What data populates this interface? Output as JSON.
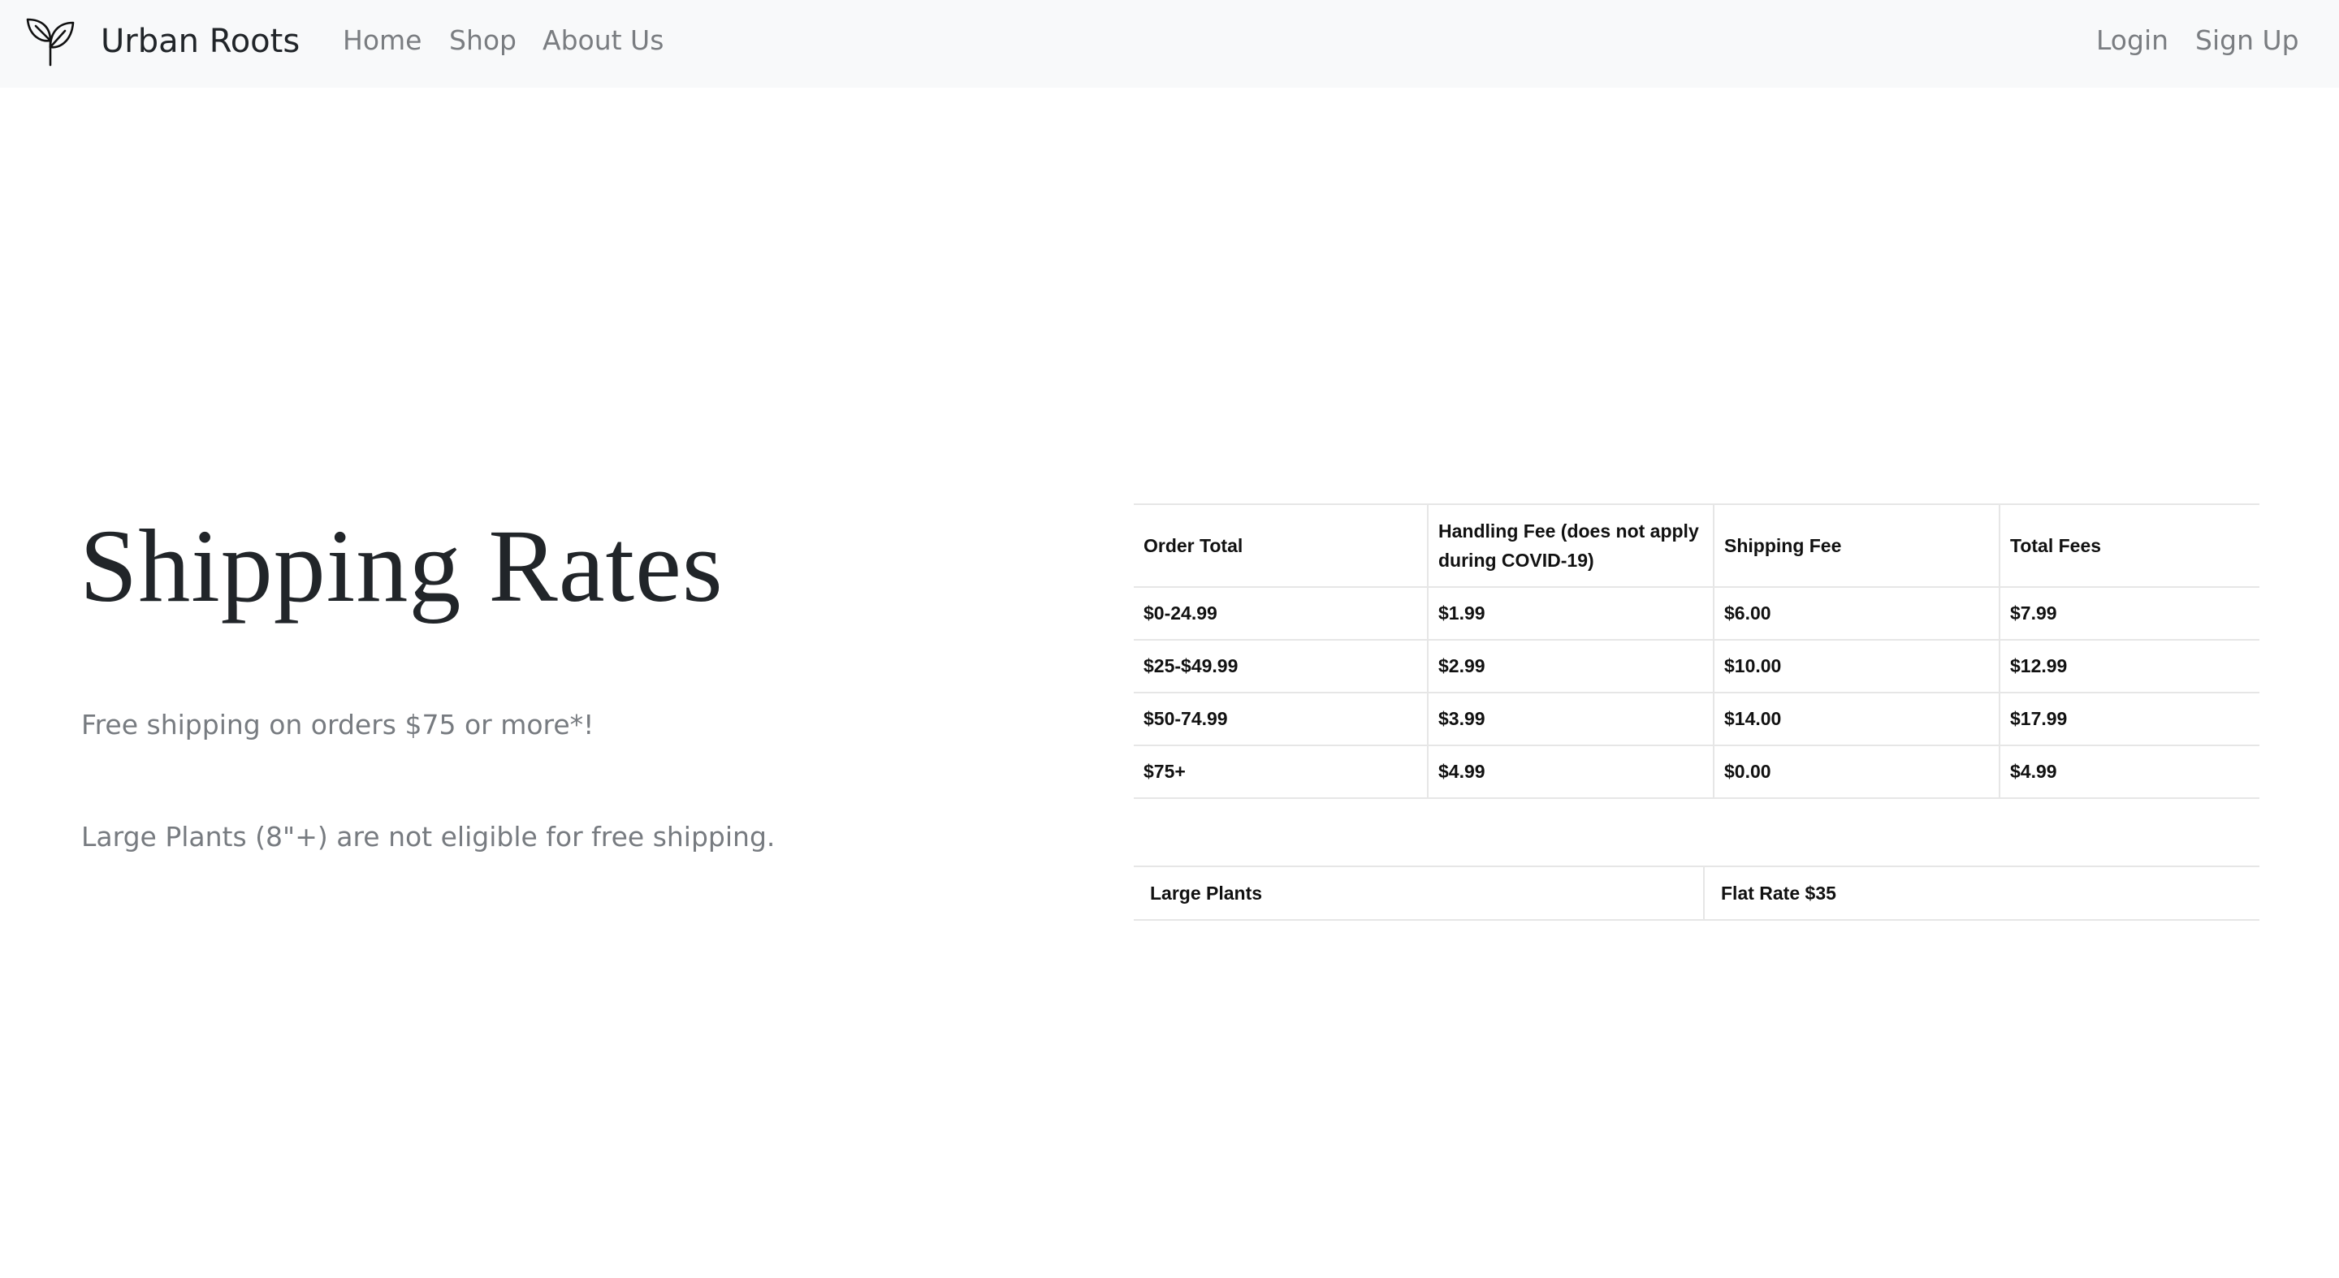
{
  "navbar": {
    "brand_icon": "sprout-icon",
    "brand_name": "Urban Roots",
    "links": [
      "Home",
      "Shop",
      "About Us"
    ],
    "auth_links": [
      "Login",
      "Sign Up"
    ]
  },
  "main": {
    "title": "Shipping Rates",
    "free_shipping_note": "Free shipping on orders $75 or more*!",
    "large_plants_note": "Large Plants (8\"+) are not eligible for free shipping."
  },
  "rates_table": {
    "headers": [
      "Order Total",
      "Handling Fee (does not apply during COVID-19)",
      "Shipping Fee",
      "Total Fees"
    ],
    "rows": [
      [
        "$0-24.99",
        "$1.99",
        "$6.00",
        "$7.99"
      ],
      [
        "$25-$49.99",
        "$2.99",
        "$10.00",
        "$12.99"
      ],
      [
        "$50-74.99",
        "$3.99",
        "$14.00",
        "$17.99"
      ],
      [
        "$75+",
        "$4.99",
        "$0.00",
        "$4.99"
      ]
    ]
  },
  "large_plants_table": {
    "label": "Large Plants",
    "rate": "Flat Rate $35"
  },
  "colors": {
    "navbar_bg": "#f8f9fa",
    "nav_link": "#7a7d81",
    "heading": "#212529",
    "muted_text": "#777b80",
    "table_border": "#e6e6e6"
  }
}
